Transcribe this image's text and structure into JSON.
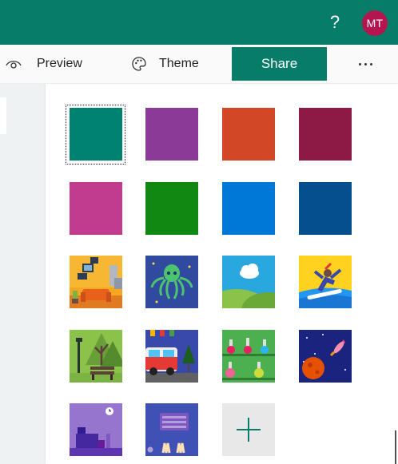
{
  "header": {
    "help_icon": "question-mark-icon",
    "help_label": "?",
    "avatar_initials": "MT",
    "bar_color": "#077d69",
    "avatar_color": "#b4154f"
  },
  "toolbar": {
    "preview_label": "Preview",
    "preview_icon": "eye-icon",
    "theme_label": "Theme",
    "theme_icon": "palette-icon",
    "share_label": "Share",
    "more_icon": "more-options-icon",
    "accent": "#077d69"
  },
  "themes": {
    "selected_index": 0,
    "colors": [
      {
        "name": "teal",
        "hex": "#008272"
      },
      {
        "name": "purple",
        "hex": "#8b3a98"
      },
      {
        "name": "orange",
        "hex": "#d24726"
      },
      {
        "name": "crimson",
        "hex": "#8c1a45"
      },
      {
        "name": "magenta",
        "hex": "#c13b8e"
      },
      {
        "name": "green",
        "hex": "#118811"
      },
      {
        "name": "blue",
        "hex": "#0078d7"
      },
      {
        "name": "navy",
        "hex": "#064f8e"
      }
    ],
    "images": [
      "living-room-image",
      "octopus-image",
      "cloud-landscape-image",
      "snowboarder-image",
      "forest-park-image",
      "camper-van-image",
      "laboratory-flasks-image",
      "space-rocket-image",
      "study-desk-image",
      "keyboard-image"
    ],
    "add_icon": "plus-icon"
  }
}
